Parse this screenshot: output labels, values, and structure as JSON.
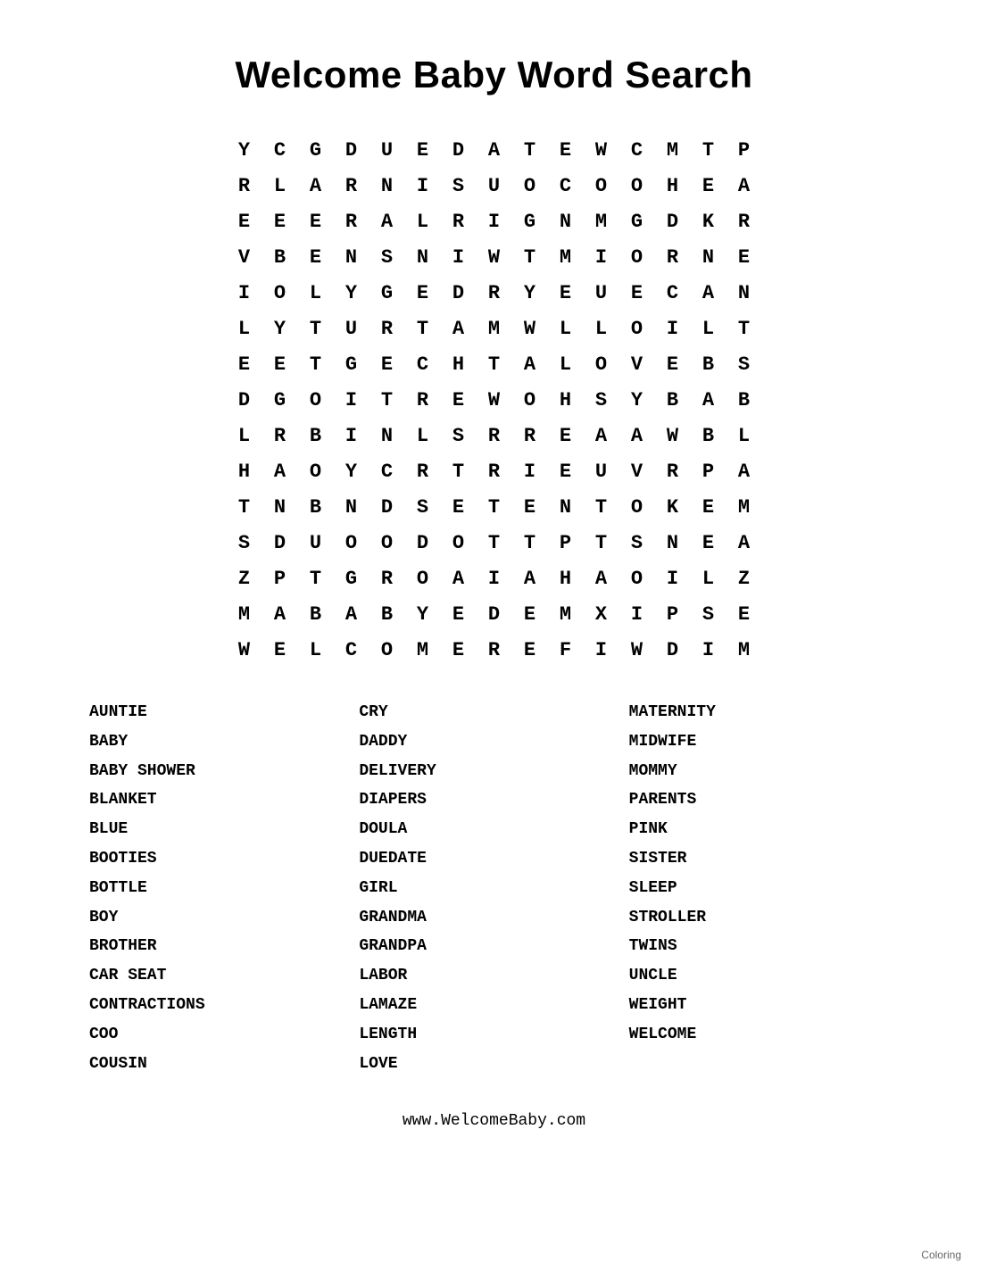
{
  "title": "Welcome Baby Word Search",
  "grid": [
    [
      "Y",
      "C",
      "G",
      "D",
      "U",
      "E",
      "D",
      "A",
      "T",
      "E",
      "W",
      "C",
      "M",
      "T",
      "P"
    ],
    [
      "R",
      "L",
      "A",
      "R",
      "N",
      "I",
      "S",
      "U",
      "O",
      "C",
      "O",
      "O",
      "H",
      "E",
      "A"
    ],
    [
      "E",
      "E",
      "E",
      "R",
      "A",
      "L",
      "R",
      "I",
      "G",
      "N",
      "M",
      "G",
      "D",
      "K",
      "R"
    ],
    [
      "V",
      "B",
      "E",
      "N",
      "S",
      "N",
      "I",
      "W",
      "T",
      "M",
      "I",
      "O",
      "R",
      "N",
      "E"
    ],
    [
      "I",
      "O",
      "L",
      "Y",
      "G",
      "E",
      "D",
      "R",
      "Y",
      "E",
      "U",
      "E",
      "C",
      "A",
      "N"
    ],
    [
      "L",
      "Y",
      "T",
      "U",
      "R",
      "T",
      "A",
      "M",
      "W",
      "L",
      "L",
      "O",
      "I",
      "L",
      "T"
    ],
    [
      "E",
      "E",
      "T",
      "G",
      "E",
      "C",
      "H",
      "T",
      "A",
      "L",
      "O",
      "V",
      "E",
      "B",
      "S"
    ],
    [
      "D",
      "G",
      "O",
      "I",
      "T",
      "R",
      "E",
      "W",
      "O",
      "H",
      "S",
      "Y",
      "B",
      "A",
      "B"
    ],
    [
      "L",
      "R",
      "B",
      "I",
      "N",
      "L",
      "S",
      "R",
      "R",
      "E",
      "A",
      "A",
      "W",
      "B",
      "L"
    ],
    [
      "H",
      "A",
      "O",
      "Y",
      "C",
      "R",
      "T",
      "R",
      "I",
      "E",
      "U",
      "V",
      "R",
      "P",
      "A"
    ],
    [
      "T",
      "N",
      "B",
      "N",
      "D",
      "S",
      "E",
      "T",
      "E",
      "N",
      "T",
      "O",
      "K",
      "E",
      "M"
    ],
    [
      "S",
      "D",
      "U",
      "O",
      "O",
      "D",
      "O",
      "T",
      "T",
      "P",
      "T",
      "S",
      "N",
      "E",
      "A"
    ],
    [
      "Z",
      "P",
      "T",
      "G",
      "R",
      "O",
      "A",
      "I",
      "A",
      "H",
      "A",
      "O",
      "I",
      "L",
      "Z"
    ],
    [
      "M",
      "A",
      "B",
      "A",
      "B",
      "Y",
      "E",
      "D",
      "E",
      "M",
      "X",
      "I",
      "P",
      "S",
      "E"
    ],
    [
      "W",
      "E",
      "L",
      "C",
      "O",
      "M",
      "E",
      "R",
      "E",
      "F",
      "I",
      "W",
      "D",
      "I",
      "M"
    ]
  ],
  "word_columns": [
    {
      "words": [
        "AUNTIE",
        "BABY",
        "BABY SHOWER",
        "BLANKET",
        "BLUE",
        "BOOTIES",
        "BOTTLE",
        "BOY",
        "BROTHER",
        "CAR SEAT",
        "CONTRACTIONS",
        "COO",
        "COUSIN"
      ]
    },
    {
      "words": [
        "CRY",
        "DADDY",
        "DELIVERY",
        "DIAPERS",
        "DOULA",
        "DUEDATE",
        "GIRL",
        "GRANDMA",
        "GRANDPA",
        "LABOR",
        "LAMAZE",
        "LENGTH",
        "LOVE"
      ]
    },
    {
      "words": [
        "MATERNITY",
        "MIDWIFE",
        "MOMMY",
        "PARENTS",
        "PINK",
        "SISTER",
        "SLEEP",
        "STROLLER",
        "TWINS",
        "UNCLE",
        "WEIGHT",
        "WELCOME"
      ]
    }
  ],
  "footer_url": "www.WelcomeBaby.com",
  "coloring_label": "Coloring"
}
